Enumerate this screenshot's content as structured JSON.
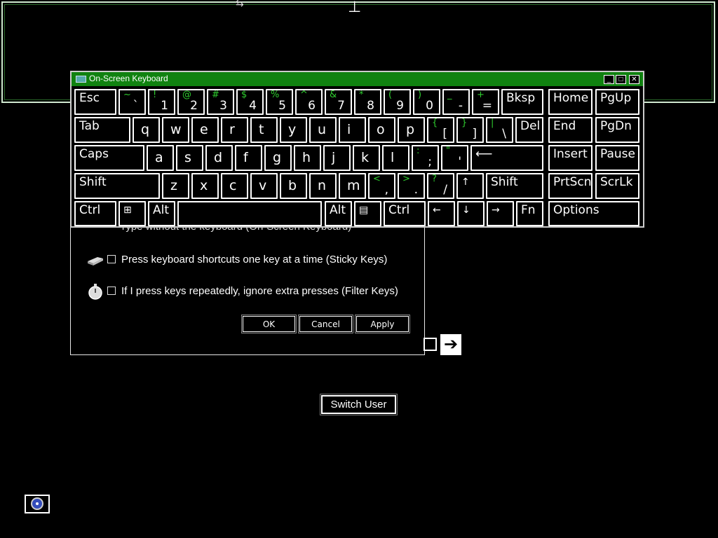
{
  "frame": {
    "mark1": "⇆",
    "mark2": "⊥"
  },
  "dialog": {
    "partial_text": "Type without the keyboard (On-Screen Keyboard)",
    "sticky_label": "Press keyboard shortcuts one key at a time (Sticky Keys)",
    "filter_label": "If I press keys repeatedly, ignore extra presses (Filter Keys)",
    "ok": "OK",
    "cancel": "Cancel",
    "apply": "Apply"
  },
  "go_arrow": "➔",
  "switch_user": "Switch User",
  "osk": {
    "title": "On-Screen Keyboard",
    "min": "_",
    "max": "□",
    "close": "✕",
    "keys": {
      "esc": "Esc",
      "tick_s": "~",
      "tick_b": "`",
      "k1s": "!",
      "k1": "1",
      "k2s": "@",
      "k2": "2",
      "k3s": "#",
      "k3": "3",
      "k4s": "$",
      "k4": "4",
      "k5s": "%",
      "k5": "5",
      "k6s": "^",
      "k6": "6",
      "k7s": "&",
      "k7": "7",
      "k8s": "*",
      "k8": "8",
      "k9s": "(",
      "k9": "9",
      "k0s": ")",
      "k0": "0",
      "minus_s": "_",
      "minus": "-",
      "eq_s": "+",
      "eq": "=",
      "bksp": "Bksp",
      "home": "Home",
      "pgup": "PgUp",
      "tab": "Tab",
      "q": "q",
      "w": "w",
      "e": "e",
      "r": "r",
      "t": "t",
      "y": "y",
      "u": "u",
      "i": "i",
      "o": "o",
      "p": "p",
      "lbr_s": "{",
      "lbr": "[",
      "rbr_s": "}",
      "rbr": "]",
      "bsl_s": "|",
      "bsl": "\\",
      "del": "Del",
      "end": "End",
      "pgdn": "PgDn",
      "caps": "Caps",
      "a": "a",
      "s": "s",
      "d": "d",
      "f": "f",
      "g": "g",
      "h": "h",
      "j": "j",
      "k": "k",
      "l": "l",
      "semi_s": ":",
      "semi": ";",
      "quote_s": "\"",
      "quote": "'",
      "enter": "⟵",
      "insert": "Insert",
      "pause": "Pause",
      "lshift": "Shift",
      "z": "z",
      "x": "x",
      "c": "c",
      "v": "v",
      "b": "b",
      "n": "n",
      "m": "m",
      "comma_s": "<",
      "comma": ",",
      "dot_s": ">",
      "dot": ".",
      "slash_s": "?",
      "slash": "/",
      "up": "↑",
      "rshift": "Shift",
      "prtscn": "PrtScn",
      "scrlk": "ScrLk",
      "lctrl": "Ctrl",
      "win": "⊞",
      "lalt": "Alt",
      "space": "",
      "ralt": "Alt",
      "menu": "▤",
      "rctrl": "Ctrl",
      "left": "←",
      "down": "↓",
      "right": "→",
      "fn": "Fn",
      "options": "Options"
    }
  }
}
